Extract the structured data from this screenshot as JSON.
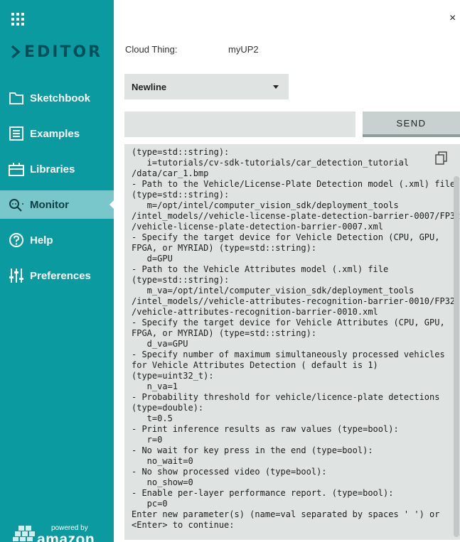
{
  "app": {
    "brand": "EDITOR",
    "powered_by": "powered by",
    "amazon": "amazon",
    "close_glyph": "×"
  },
  "sidebar": {
    "items": [
      {
        "label": "Sketchbook",
        "icon": "folder-icon",
        "active": false
      },
      {
        "label": "Examples",
        "icon": "list-icon",
        "active": false
      },
      {
        "label": "Libraries",
        "icon": "libraries-icon",
        "active": false
      },
      {
        "label": "Monitor",
        "icon": "monitor-search-icon",
        "active": true
      },
      {
        "label": "Help",
        "icon": "help-icon",
        "active": false
      },
      {
        "label": "Preferences",
        "icon": "sliders-icon",
        "active": false
      }
    ]
  },
  "monitor": {
    "cloud_thing_label": "Cloud Thing:",
    "cloud_thing_value": "myUP2",
    "line_ending": "Newline",
    "message_value": "",
    "send_label": "SEND",
    "console_output": "(type=std::string):\n   i=tutorials/cv-sdk-tutorials/car_detection_tutorial\n/data/car_1.bmp\n- Path to the Vehicle/License-Plate Detection model (.xml) file\n(type=std::string):\n   m=/opt/intel/computer_vision_sdk/deployment_tools\n/intel_models//vehicle-license-plate-detection-barrier-0007/FP32\n/vehicle-license-plate-detection-barrier-0007.xml\n- Specify the target device for Vehicle Detection (CPU, GPU,\nFPGA, or MYRIAD) (type=std::string):\n   d=GPU\n- Path to the Vehicle Attributes model (.xml) file\n(type=std::string):\n   m_va=/opt/intel/computer_vision_sdk/deployment_tools\n/intel_models//vehicle-attributes-recognition-barrier-0010/FP32\n/vehicle-attributes-recognition-barrier-0010.xml\n- Specify the target device for Vehicle Attributes (CPU, GPU,\nFPGA, or MYRIAD) (type=std::string):\n   d_va=GPU\n- Specify number of maximum simultaneously processed vehicles\nfor Vehicle Attributes Detection ( default is 1)\n(type=uint32_t):\n   n_va=1\n- Probability threshold for vehicle/licence-plate detections\n(type=double):\n   t=0.5\n- Print inference results as raw values (type=bool):\n   r=0\n- No wait for key press in the end (type=bool):\n   no_wait=0\n- No show processed video (type=bool):\n   no_show=0\n- Enable per-layer performance report. (type=bool):\n   pc=0\nEnter new parameter(s) (name=val separated by spaces ' ') or\n<Enter> to continue:"
  },
  "colors": {
    "sidebar_bg": "#0a9aa0",
    "active_item_bg": "#79c7ca",
    "brand_text": "#044e58",
    "panel_gray": "#dfe4e3"
  }
}
